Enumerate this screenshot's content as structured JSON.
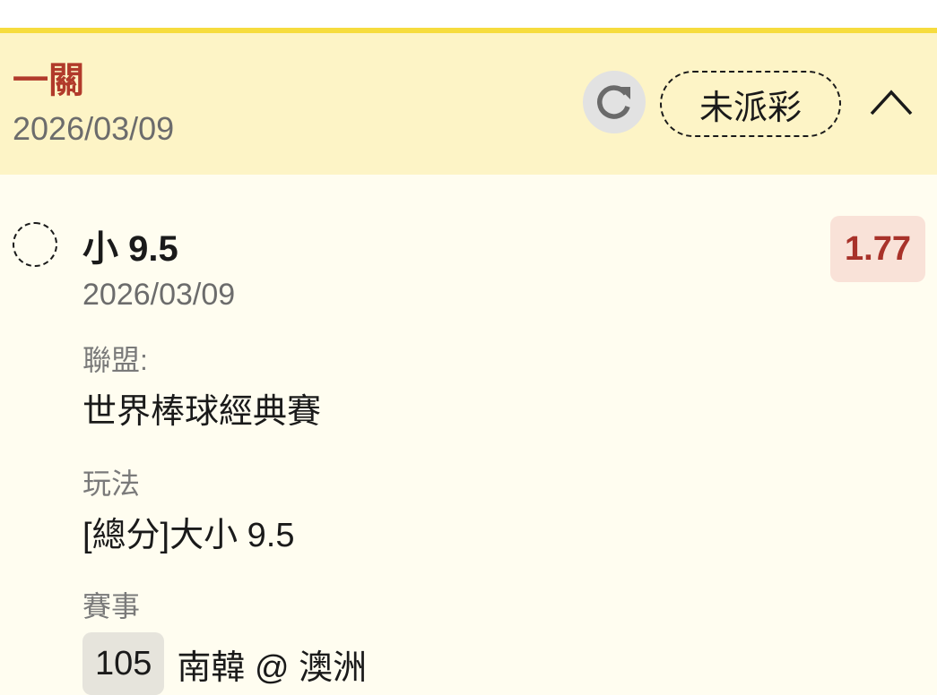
{
  "header": {
    "bet_type": "一關",
    "date": "2026/03/09",
    "status": "未派彩"
  },
  "selection": {
    "label": "小 9.5",
    "date": "2026/03/09",
    "odds": "1.77"
  },
  "details": {
    "league_label": "聯盟:",
    "league_value": "世界棒球經典賽",
    "play_label": "玩法",
    "play_value": "[總分]大小 9.5",
    "event_label": "賽事",
    "event_number": "105",
    "event_teams": "南韓 @ 澳洲"
  },
  "colors": {
    "accent_line": "#f6dc3e",
    "header_bg": "#fdf4c6",
    "body_bg": "#fffdf0",
    "bet_type_red": "#b13a2b",
    "odds_red": "#a8322a",
    "odds_bg": "#f9e2d8"
  },
  "icons": {
    "refresh": "refresh-icon",
    "collapse": "chevron-up-icon",
    "radio": "radio-unchecked-icon"
  }
}
